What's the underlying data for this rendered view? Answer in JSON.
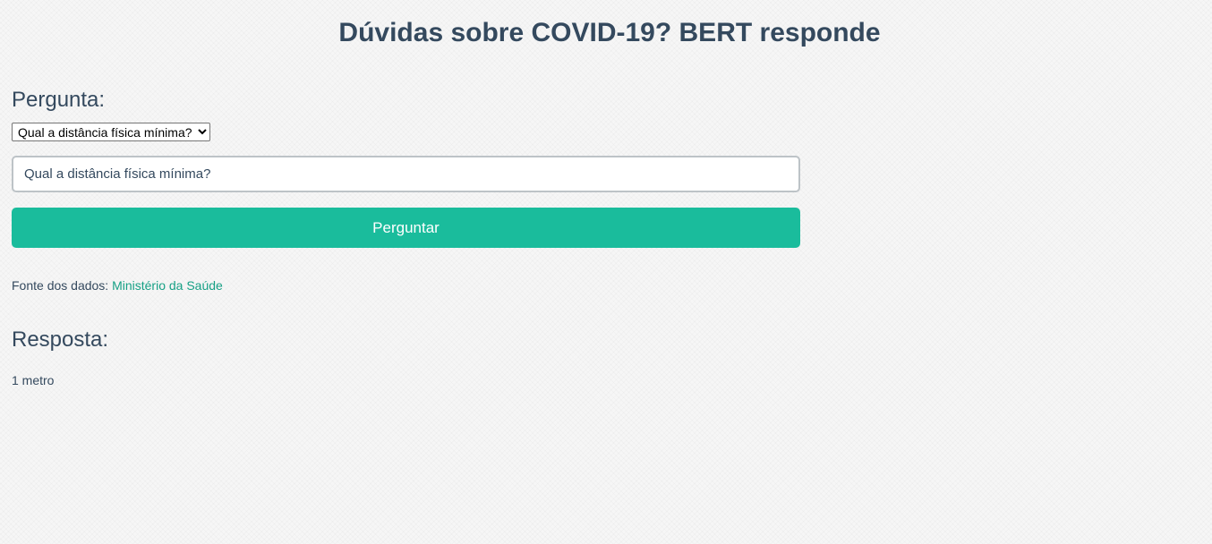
{
  "header": {
    "title": "Dúvidas sobre COVID-19? BERT responde"
  },
  "question_section": {
    "heading": "Pergunta:",
    "preset_select": {
      "selected": "Qual a distância física mínima?"
    },
    "input": {
      "value": "Qual a distância física mínima?"
    },
    "submit_label": "Perguntar"
  },
  "source": {
    "prefix": "Fonte dos dados:",
    "link_text": "Ministério da Saúde"
  },
  "answer_section": {
    "heading": "Resposta:",
    "text": "1 metro"
  },
  "colors": {
    "accent": "#1abc9c",
    "text": "#34495e",
    "link": "#16a085"
  }
}
